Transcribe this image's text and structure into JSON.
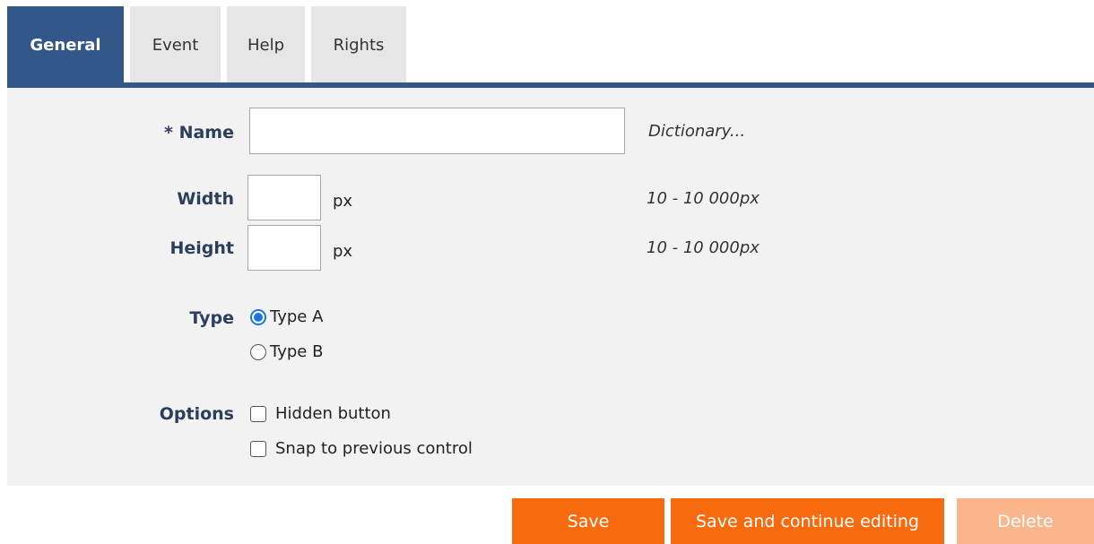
{
  "tabs": [
    {
      "label": "General",
      "active": true
    },
    {
      "label": "Event",
      "active": false
    },
    {
      "label": "Help",
      "active": false
    },
    {
      "label": "Rights",
      "active": false
    }
  ],
  "form": {
    "name": {
      "label": "* Name",
      "value": "",
      "hint": "Dictionary..."
    },
    "width": {
      "label": "Width",
      "value": "",
      "unit": "px",
      "hint": "10 - 10 000px"
    },
    "height": {
      "label": "Height",
      "value": "",
      "unit": "px",
      "hint": "10 - 10 000px"
    },
    "type": {
      "label": "Type",
      "options": [
        {
          "label": "Type A",
          "checked": true
        },
        {
          "label": "Type B",
          "checked": false
        }
      ]
    },
    "options": {
      "label": "Options",
      "items": [
        {
          "label": "Hidden button",
          "checked": false
        },
        {
          "label": "Snap to previous control",
          "checked": false
        }
      ]
    }
  },
  "buttons": {
    "save": "Save",
    "save_continue": "Save and continue editing",
    "delete": "Delete"
  },
  "colors": {
    "accent": "#34578a",
    "button": "#f76b0e",
    "button_disabled": "#fbb58a",
    "panel": "#f2f2f2"
  }
}
